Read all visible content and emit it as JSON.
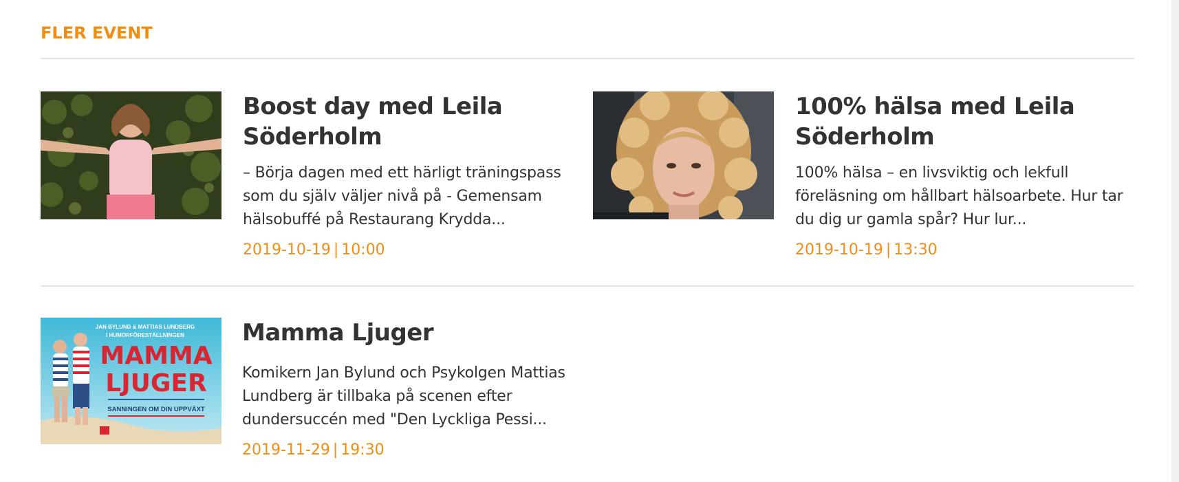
{
  "section": {
    "title": "FLER EVENT"
  },
  "events": [
    {
      "title": "Boost day med Leila Söderholm",
      "description": "– Börja dagen med ett härligt träningspass som du själv väljer nivå på - Gemensam hälsobuffé på Restaurang Krydda...",
      "date": "2019-10-19",
      "time": "10:00"
    },
    {
      "title": "100% hälsa med Leila Söderholm",
      "description": "100% hälsa – en livsviktig och lekfull föreläsning om hållbart hälsoarbete. Hur tar du dig ur gamla spår? Hur lur...",
      "date": "2019-10-19",
      "time": "13:30"
    },
    {
      "title": "Mamma Ljuger",
      "description": "Komikern Jan Bylund och Psykolgen Mattias Lundberg är tillbaka på scenen efter dundersuccén med \"Den Lyckliga Pessi...",
      "date": "2019-11-29",
      "time": "19:30",
      "poster": {
        "top_line1": "JAN BYLUND & MATTIAS LUNDBERG",
        "top_line2": "I HUMORFÖRESTÄLLNINGEN",
        "headline1": "MAMMA",
        "headline2": "LJUGER",
        "tagline": "SANNINGEN OM DIN UPPVÄXT"
      }
    }
  ],
  "separator": "|",
  "colors": {
    "accent": "#ef8e12",
    "text": "#333333",
    "rule": "#e3e3e3"
  }
}
